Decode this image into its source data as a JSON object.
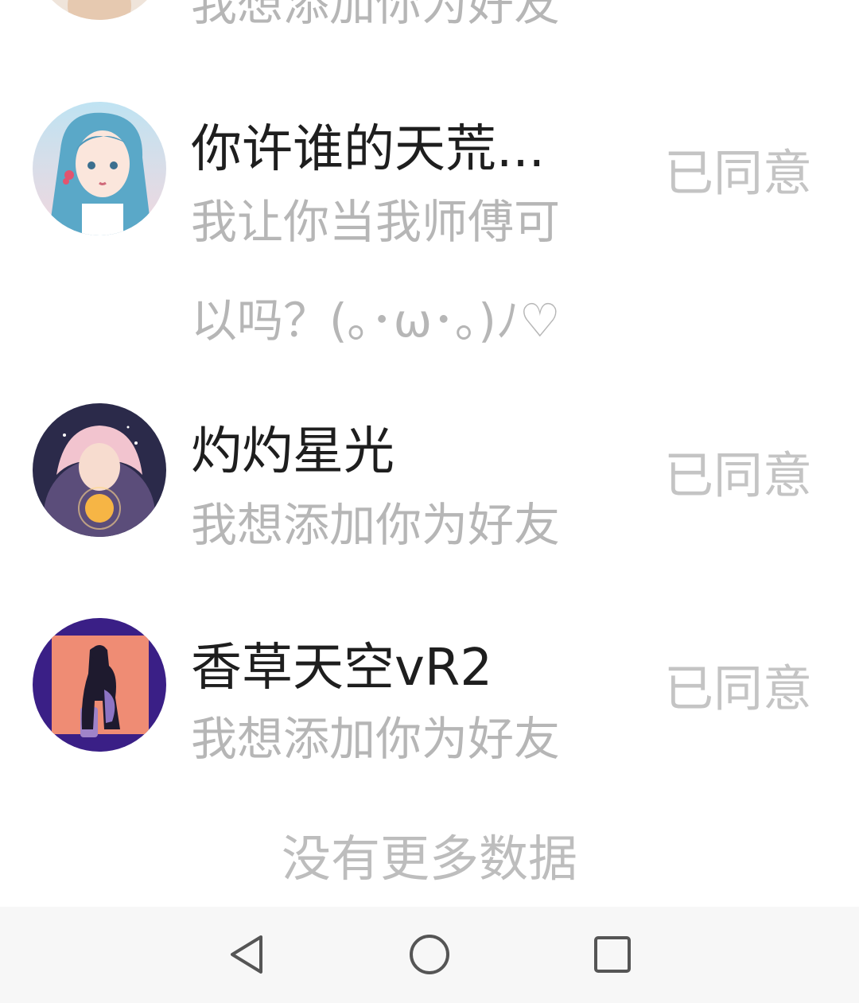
{
  "requests": [
    {
      "name": "",
      "message": "我想添加你为好友",
      "status": "",
      "avatar": "avatar-partial"
    },
    {
      "name": "你许谁的天荒...",
      "message": "我让你当我师傅可以吗？(｡･ω･｡)ﾉ♡",
      "status": "已同意",
      "avatar": "avatar-blue-hair-girl"
    },
    {
      "name": "灼灼星光",
      "message": "我想添加你为好友",
      "status": "已同意",
      "avatar": "avatar-starlight-girl"
    },
    {
      "name": "香草天空vR2",
      "message": "我想添加你为好友",
      "status": "已同意",
      "avatar": "avatar-silhouette-boy"
    }
  ],
  "footer": {
    "no_more": "没有更多数据"
  },
  "navbar": {
    "back_icon": "back-triangle-icon",
    "home_icon": "home-circle-icon",
    "recents_icon": "recents-square-icon"
  },
  "colors": {
    "name_text": "#1e1e1e",
    "message_text": "#b6b6b6",
    "status_text": "#c4c4c4",
    "navbar_bg": "#f7f7f7"
  }
}
